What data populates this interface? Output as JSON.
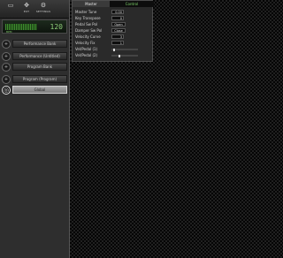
{
  "toolbar": {
    "buttons": [
      {
        "glyph": "▭",
        "label": ""
      },
      {
        "glyph": "✥",
        "label": "EXT"
      },
      {
        "glyph": "⚙",
        "label": "SETTINGS"
      }
    ]
  },
  "lcd": {
    "value": "120",
    "tag": "BPM"
  },
  "nav": {
    "items": [
      {
        "icon": "+",
        "label": "Performance Bank"
      },
      {
        "icon": "+",
        "label": "Performance (Untitled)"
      },
      {
        "icon": "+",
        "label": "Program Bank"
      },
      {
        "icon": "+",
        "label": "Program (Program)"
      },
      {
        "icon": "◎",
        "label": "Global",
        "active": true
      }
    ]
  },
  "params": {
    "tabs": {
      "master": "Master",
      "control": "Control"
    },
    "rows": [
      {
        "label": "Master Tune",
        "value": "0.00",
        "kind": "value"
      },
      {
        "label": "Key Transpose",
        "value": "0",
        "kind": "value"
      },
      {
        "label": "Pedal Sw Pol",
        "value": "Open",
        "kind": "wide"
      },
      {
        "label": "Damper Sw Pol",
        "value": "Close",
        "kind": "wide"
      },
      {
        "label": "Velocity Curve",
        "value": "3",
        "kind": "value"
      },
      {
        "label": "Velocity Fix",
        "value": "1",
        "kind": "value"
      },
      {
        "label": "Vel/Pedal (1)",
        "value": 0.05,
        "kind": "slider"
      },
      {
        "label": "Vel/Pedal (2)",
        "value": 0.25,
        "kind": "slider"
      }
    ]
  },
  "colors": {
    "accent": "#7fd66b",
    "active_button": "#a8a8a8"
  }
}
